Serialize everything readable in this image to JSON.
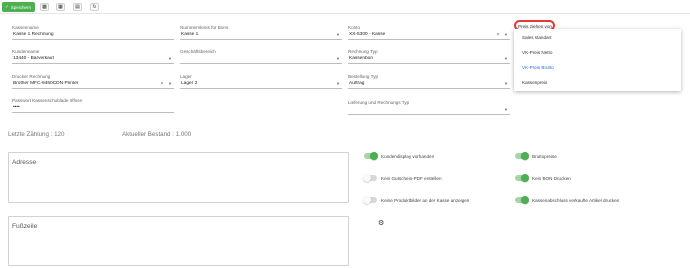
{
  "toolbar": {
    "save_label": "Speichern",
    "icons": [
      "save-icon",
      "cash-register-icon",
      "calculator-icon",
      "printer-icon",
      "refresh-icon"
    ]
  },
  "form": {
    "kassenname": {
      "label": "Kassenname",
      "value": "Kasse 1 Rechnung"
    },
    "nummernkreis": {
      "label": "Nummernkreis für Bons",
      "value": "Kasse 1"
    },
    "konto": {
      "label": "Konto",
      "value": "XX-5300 - Kasse"
    },
    "preis": {
      "label": "Preis ziehen von"
    },
    "kunde": {
      "label": "Kundenname",
      "value": "13440 - Barverkauf"
    },
    "geschaeftsbereich": {
      "label": "Geschäftsbereich",
      "value": ""
    },
    "rechnung_typ": {
      "label": "Rechnung Typ",
      "value": "Kassenbon"
    },
    "drucker": {
      "label": "Drucker Rechnung",
      "value": "Brother MFC-9460CDN Printer"
    },
    "lager": {
      "label": "Lager",
      "value": "Lager 2"
    },
    "bestellung_typ": {
      "label": "Bestellung Typ",
      "value": "Auftrag"
    },
    "passwort": {
      "label": "Passwort Kassenschublade öffnen",
      "value": "••••"
    },
    "lieferung_typ": {
      "label": "Lieferung und Rechnungs Typ",
      "value": ""
    }
  },
  "stats": {
    "letzte_zaehlung": "Letzte Zählung : 120",
    "aktueller_bestand": "Aktueller Bestand : 1.000"
  },
  "boxes": {
    "adresse": "Adresse",
    "fusszeile": "Fußzeile"
  },
  "toggles": [
    {
      "label": "Kundendisplay vorhanden",
      "on": true
    },
    {
      "label": "Bruttopreise",
      "on": true
    },
    {
      "label": "Kein Gutschein-PDF erstellen",
      "on": false
    },
    {
      "label": "Kein BON Drucken",
      "on": true
    },
    {
      "label": "Keine Produktbilder an der Kasse anzeigen",
      "on": false
    },
    {
      "label": "Kassenabschluss verkaufte Artikel drucken",
      "on": true
    }
  ],
  "dropdown": {
    "options": [
      "Sales standart",
      "VK-Preis Netto",
      "VK-Preis Brutto",
      "Kassenpreis"
    ],
    "selected": "VK-Preis Brutto"
  },
  "colors": {
    "accent": "#4caf50",
    "selected": "#1e6fd9",
    "highlight": "#e53935"
  }
}
